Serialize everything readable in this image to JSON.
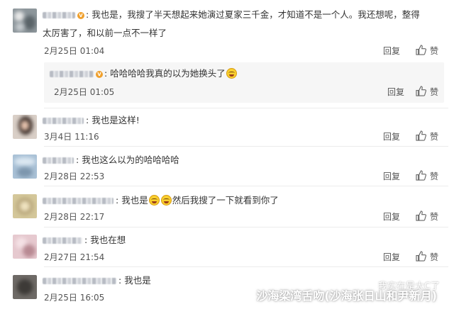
{
  "comments": [
    {
      "text_line1": "我也是，我搜了半天想起来她演过夏家三千金，才知道不是一个人。我还想呢，整得",
      "text_line2": "太厉害了，和以前一点不一样了",
      "time": "2月25日 01:04",
      "reply": "回复",
      "like": "赞",
      "verified_badge": "V",
      "sub_reply": {
        "text": "哈哈哈哈我真的以为她换头了",
        "time": "2月25日 01:05",
        "reply": "回复",
        "like": "赞",
        "verified_badge": "V"
      }
    },
    {
      "text": "我也是这样!",
      "time": "3月4日 11:16",
      "reply": "回复",
      "like": "赞"
    },
    {
      "text": "我也这么以为的哈哈哈哈",
      "time": "2月28日 22:53",
      "reply": "回复",
      "like": "赞"
    },
    {
      "text_before": "我也是",
      "text_after": "然后我搜了一下就看到你了",
      "time": "2月28日 22:17",
      "reply": "回复",
      "like": "赞"
    },
    {
      "text": "我也在想",
      "time": "2月27日 21:54",
      "reply": "回复",
      "like": "赞"
    },
    {
      "text": "我也是",
      "time": "2月25日 16:05"
    }
  ],
  "watermark": {
    "line1": "我实在是太C了",
    "line2": "沙海梁湾舌吻(沙海张日山和尹新月)"
  },
  "colors": {
    "text": "#333333",
    "meta": "#555555",
    "subbox": "#f6f6f6",
    "divider": "#ececec",
    "verified": "#f0a02c"
  },
  "icons": [
    "thumb-up-icon",
    "laughing-emoji-icon",
    "verified-badge-icon",
    "wechat-icon"
  ]
}
